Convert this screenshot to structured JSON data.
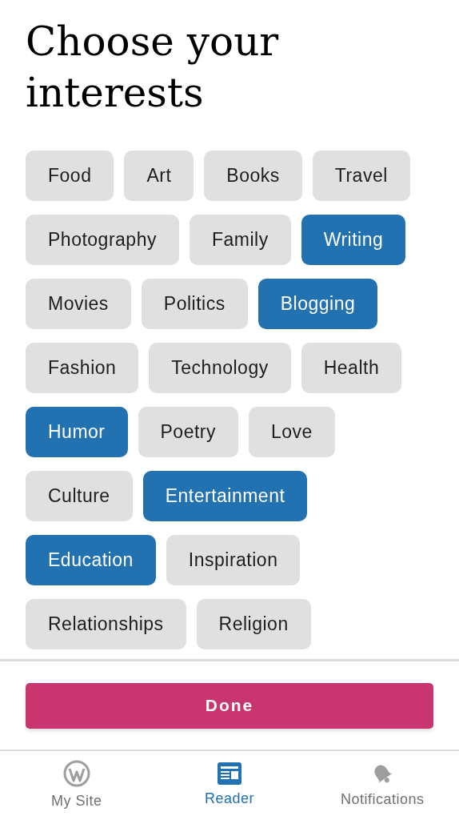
{
  "title": "Choose your interests",
  "interest_rows": [
    [
      {
        "label": "Food",
        "selected": false
      },
      {
        "label": "Art",
        "selected": false
      },
      {
        "label": "Books",
        "selected": false
      },
      {
        "label": "Travel",
        "selected": false
      }
    ],
    [
      {
        "label": "Photography",
        "selected": false
      },
      {
        "label": "Family",
        "selected": false
      },
      {
        "label": "Writing",
        "selected": true
      }
    ],
    [
      {
        "label": "Movies",
        "selected": false
      },
      {
        "label": "Politics",
        "selected": false
      },
      {
        "label": "Blogging",
        "selected": true
      }
    ],
    [
      {
        "label": "Fashion",
        "selected": false
      },
      {
        "label": "Technology",
        "selected": false
      },
      {
        "label": "Health",
        "selected": false
      }
    ],
    [
      {
        "label": "Humor",
        "selected": true
      },
      {
        "label": "Poetry",
        "selected": false
      },
      {
        "label": "Love",
        "selected": false
      }
    ],
    [
      {
        "label": "Culture",
        "selected": false
      },
      {
        "label": "Entertainment",
        "selected": true
      }
    ],
    [
      {
        "label": "Education",
        "selected": true
      },
      {
        "label": "Inspiration",
        "selected": false
      }
    ],
    [
      {
        "label": "Relationships",
        "selected": false
      },
      {
        "label": "Religion",
        "selected": false
      }
    ]
  ],
  "done_button": "Done",
  "bottom_nav": [
    {
      "kind": "mysite",
      "label": "My Site",
      "selected": false
    },
    {
      "kind": "reader",
      "label": "Reader",
      "selected": true
    },
    {
      "kind": "notifications",
      "label": "Notifications",
      "selected": false
    }
  ]
}
